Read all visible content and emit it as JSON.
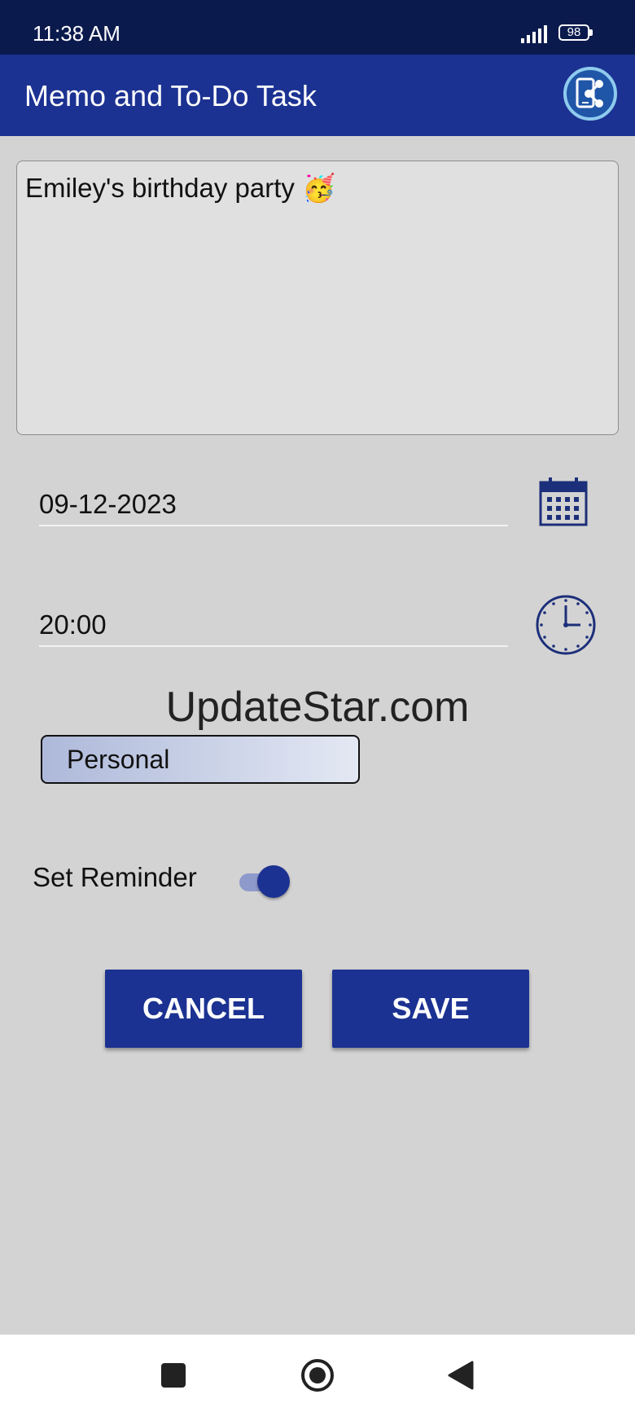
{
  "status_bar": {
    "time": "11:38 AM",
    "battery": "98"
  },
  "app_bar": {
    "title": "Memo and To-Do Task"
  },
  "memo": {
    "text": "Emiley's birthday party 🥳"
  },
  "date": {
    "value": "09-12-2023"
  },
  "time": {
    "value": "20:00"
  },
  "watermark": "UpdateStar.com",
  "category": {
    "selected": "Personal"
  },
  "reminder": {
    "label": "Set Reminder",
    "enabled": true
  },
  "actions": {
    "cancel_label": "CANCEL",
    "save_label": "SAVE"
  },
  "colors": {
    "primary": "#1c3292",
    "status_bar": "#0b1a4d",
    "background": "#d3d3d3"
  },
  "icons": [
    "share-icon",
    "calendar-icon",
    "clock-icon",
    "recent-apps-icon",
    "home-icon",
    "back-icon"
  ]
}
